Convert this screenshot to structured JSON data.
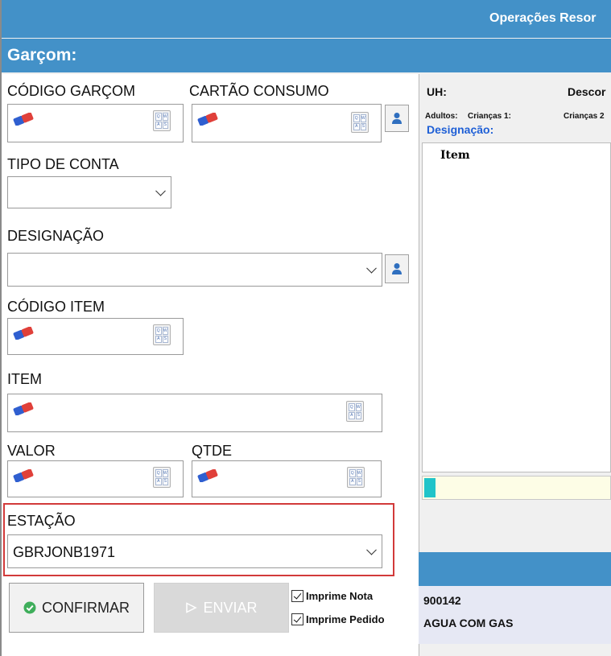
{
  "window": {
    "title": "Operações Resor"
  },
  "section": {
    "title": "Garçom:"
  },
  "fields": {
    "codigo_garcom": {
      "label": "CÓDIGO GARÇOM",
      "value": ""
    },
    "cartao_consumo": {
      "label": "CARTÃO CONSUMO",
      "value": ""
    },
    "tipo_conta": {
      "label": "TIPO DE CONTA",
      "value": ""
    },
    "designacao": {
      "label": "DESIGNAÇÃO",
      "value": ""
    },
    "codigo_item": {
      "label": "CÓDIGO ITEM",
      "value": ""
    },
    "item": {
      "label": "ITEM",
      "value": ""
    },
    "valor": {
      "label": "VALOR",
      "value": ""
    },
    "qtde": {
      "label": "QTDE",
      "value": ""
    },
    "estacao": {
      "label": "ESTAÇÃO",
      "value": "GBRJONB1971"
    }
  },
  "keyboard_keys": [
    "Q",
    "W",
    "A",
    "S"
  ],
  "buttons": {
    "confirm": "CONFIRMAR",
    "send": "ENVIAR"
  },
  "checkboxes": [
    {
      "label": "Imprime Nota",
      "checked": true
    },
    {
      "label": "Imprime Pedido",
      "checked": true
    }
  ],
  "right_panel": {
    "uh_label": "UH:",
    "desc_label": "Descor",
    "adultos_label": "Adultos:",
    "criancas1_label": "Crianças 1:",
    "criancas2_label": "Crianças 2",
    "designacao_label": "Designação:",
    "grid_header": "Item",
    "progress": 0.06,
    "order_item": {
      "code": "900142",
      "name": "AGUA COM GAS"
    }
  },
  "colors": {
    "header_blue": "#4391c8",
    "highlight_red": "#d23a3a",
    "progress_teal": "#20c4c9",
    "link_blue": "#1e5fd6"
  }
}
